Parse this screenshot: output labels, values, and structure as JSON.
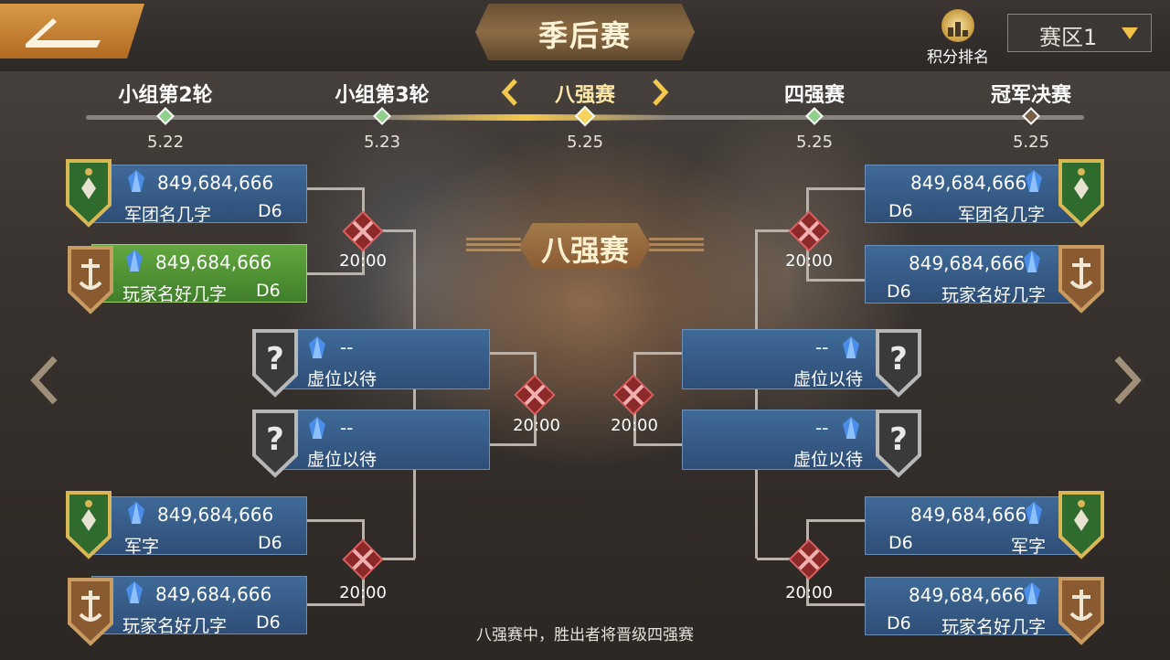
{
  "header": {
    "title": "季后赛",
    "ranking_label": "积分排名",
    "region": "赛区1"
  },
  "stages": [
    {
      "name": "小组第2轮",
      "date": "5.22",
      "state": "done"
    },
    {
      "name": "小组第3轮",
      "date": "5.23",
      "state": "done"
    },
    {
      "name": "八强赛",
      "date": "5.25",
      "state": "active"
    },
    {
      "name": "四强赛",
      "date": "5.25",
      "state": "done"
    },
    {
      "name": "冠军决赛",
      "date": "5.25",
      "state": "locked"
    }
  ],
  "banner": "八强赛",
  "left": {
    "r1": [
      {
        "score": "849,684,666",
        "name": "军团名几字",
        "division": "D6",
        "badge": "green-shield",
        "winner": false
      },
      {
        "score": "849,684,666",
        "name": "玩家名好几字",
        "division": "D6",
        "badge": "bronze-anchor",
        "winner": true
      },
      {
        "score": "849,684,666",
        "name": "军字",
        "division": "D6",
        "badge": "green-shield",
        "winner": false
      },
      {
        "score": "849,684,666",
        "name": "玩家名好几字",
        "division": "D6",
        "badge": "bronze-anchor",
        "winner": false
      }
    ],
    "r2": [
      {
        "score": "--",
        "name": "虚位以待"
      },
      {
        "score": "--",
        "name": "虚位以待"
      }
    ],
    "times": [
      "20:00",
      "20:00",
      "20:00"
    ]
  },
  "right": {
    "r1": [
      {
        "score": "849,684,666",
        "name": "军团名几字",
        "division": "D6",
        "badge": "green-shield"
      },
      {
        "score": "849,684,666",
        "name": "玩家名好几字",
        "division": "D6",
        "badge": "bronze-anchor"
      },
      {
        "score": "849,684,666",
        "name": "军字",
        "division": "D6",
        "badge": "green-shield"
      },
      {
        "score": "849,684,666",
        "name": "玩家名好几字",
        "division": "D6",
        "badge": "bronze-anchor"
      }
    ],
    "r2": [
      {
        "score": "--",
        "name": "虚位以待"
      },
      {
        "score": "--",
        "name": "虚位以待"
      }
    ],
    "times": [
      "20:00",
      "20:00",
      "20:00"
    ]
  },
  "footer": "八强赛中，胜出者将晋级四强赛",
  "colors": {
    "accent": "#f4c84c",
    "card": "#3f6a98",
    "winner": "#63a73f"
  }
}
